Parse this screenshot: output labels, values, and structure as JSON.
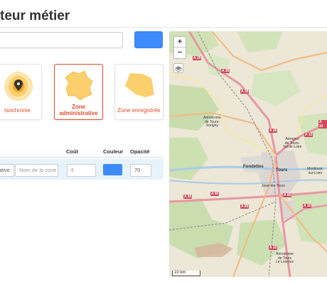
{
  "page": {
    "title": "teur métier"
  },
  "search": {
    "placeholder": ""
  },
  "cards": [
    {
      "label": "Isochronie",
      "icon": "isochrone-icon",
      "active": false
    },
    {
      "label": "Zone administrative",
      "icon": "admin-zone-icon",
      "active": true
    },
    {
      "label": "Zone enregistrée",
      "icon": "saved-zone-icon",
      "active": false
    }
  ],
  "table": {
    "headers": {
      "cost": "Coût",
      "color": "Couleur",
      "opacity": "Opacité"
    },
    "row": {
      "type_value": "ative",
      "name_placeholder": "Nom de la zone",
      "cost_placeholder": "€",
      "color": "#3d8bfd",
      "opacity": "70"
    }
  },
  "colors": {
    "accent": "#3d8bfd",
    "active": "#e24b2c",
    "row_highlight": "#e6f3fb"
  },
  "map": {
    "zoom_in": "+",
    "zoom_out": "−",
    "scale": "10 km",
    "roads": [
      "A 28",
      "A 28",
      "A 28",
      "A 28",
      "A 10",
      "A 10",
      "A 85",
      "A 85",
      "A 85",
      "A 85",
      "A 10",
      "A 10"
    ],
    "places": {
      "airport1": "Aérodrome\nde Tours-\nSorigny",
      "airport2": "Aéroport\nde Tours-\nVal de Loire",
      "fondettes": "Fondettes",
      "tours": "Tours",
      "montlouis": "Montlouis-\nsur-Loire",
      "joue": "Joué-lès-Tours",
      "airport3": "Aérodrome\nde Tours\nLe Louroux"
    }
  }
}
